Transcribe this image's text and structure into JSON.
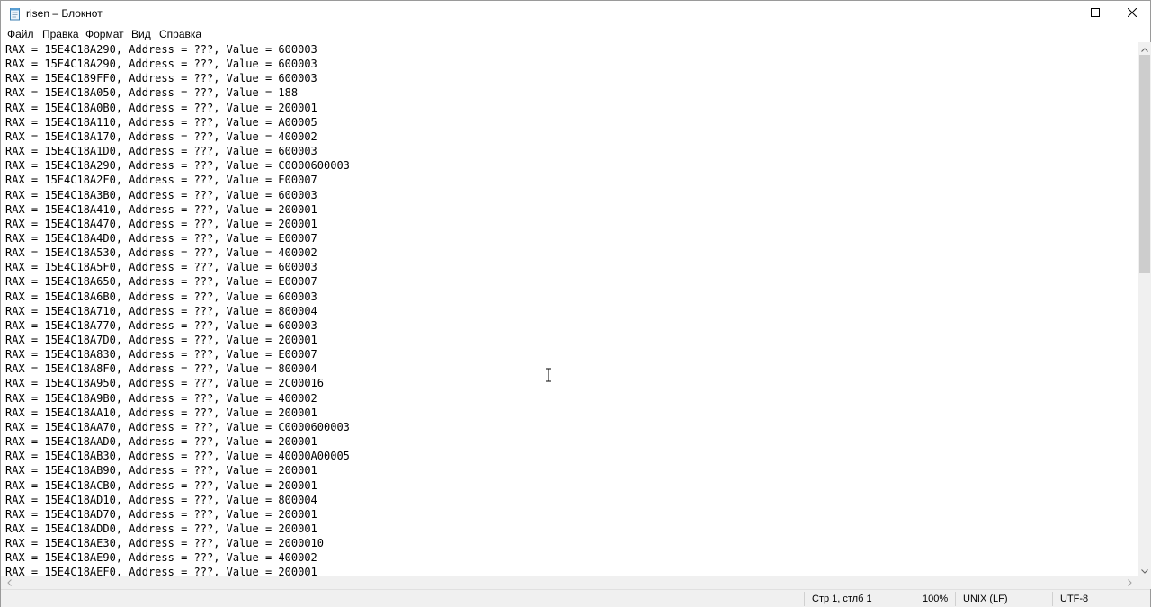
{
  "window": {
    "title": "risen – Блокнот",
    "app_icon": "notepad-icon",
    "controls": {
      "minimize": "minimize-icon",
      "maximize": "maximize-icon",
      "close": "close-icon"
    }
  },
  "menu": [
    "Файл",
    "Правка",
    "Формат",
    "Вид",
    "Справка"
  ],
  "editor": {
    "lines": [
      "RAX = 15E4C18A290, Address = ???, Value = 600003",
      "RAX = 15E4C18A290, Address = ???, Value = 600003",
      "RAX = 15E4C189FF0, Address = ???, Value = 600003",
      "RAX = 15E4C18A050, Address = ???, Value = 188",
      "RAX = 15E4C18A0B0, Address = ???, Value = 200001",
      "RAX = 15E4C18A110, Address = ???, Value = A00005",
      "RAX = 15E4C18A170, Address = ???, Value = 400002",
      "RAX = 15E4C18A1D0, Address = ???, Value = 600003",
      "RAX = 15E4C18A290, Address = ???, Value = C0000600003",
      "RAX = 15E4C18A2F0, Address = ???, Value = E00007",
      "RAX = 15E4C18A3B0, Address = ???, Value = 600003",
      "RAX = 15E4C18A410, Address = ???, Value = 200001",
      "RAX = 15E4C18A470, Address = ???, Value = 200001",
      "RAX = 15E4C18A4D0, Address = ???, Value = E00007",
      "RAX = 15E4C18A530, Address = ???, Value = 400002",
      "RAX = 15E4C18A5F0, Address = ???, Value = 600003",
      "RAX = 15E4C18A650, Address = ???, Value = E00007",
      "RAX = 15E4C18A6B0, Address = ???, Value = 600003",
      "RAX = 15E4C18A710, Address = ???, Value = 800004",
      "RAX = 15E4C18A770, Address = ???, Value = 600003",
      "RAX = 15E4C18A7D0, Address = ???, Value = 200001",
      "RAX = 15E4C18A830, Address = ???, Value = E00007",
      "RAX = 15E4C18A8F0, Address = ???, Value = 800004",
      "RAX = 15E4C18A950, Address = ???, Value = 2C00016",
      "RAX = 15E4C18A9B0, Address = ???, Value = 400002",
      "RAX = 15E4C18AA10, Address = ???, Value = 200001",
      "RAX = 15E4C18AA70, Address = ???, Value = C0000600003",
      "RAX = 15E4C18AAD0, Address = ???, Value = 200001",
      "RAX = 15E4C18AB30, Address = ???, Value = 40000A00005",
      "RAX = 15E4C18AB90, Address = ???, Value = 200001",
      "RAX = 15E4C18ACB0, Address = ???, Value = 200001",
      "RAX = 15E4C18AD10, Address = ???, Value = 800004",
      "RAX = 15E4C18AD70, Address = ???, Value = 200001",
      "RAX = 15E4C18ADD0, Address = ???, Value = 200001",
      "RAX = 15E4C18AE30, Address = ???, Value = 2000010",
      "RAX = 15E4C18AE90, Address = ???, Value = 400002",
      "RAX = 15E4C18AEF0, Address = ???, Value = 200001"
    ]
  },
  "statusbar": {
    "position": "Стр 1, стлб 1",
    "zoom": "100%",
    "line_endings": "UNIX (LF)",
    "encoding": "UTF-8"
  },
  "colors": {
    "window_bg": "#ffffff",
    "chrome_bg": "#f0f0f0",
    "scroll_thumb": "#cdcdcd",
    "text": "#000000"
  }
}
